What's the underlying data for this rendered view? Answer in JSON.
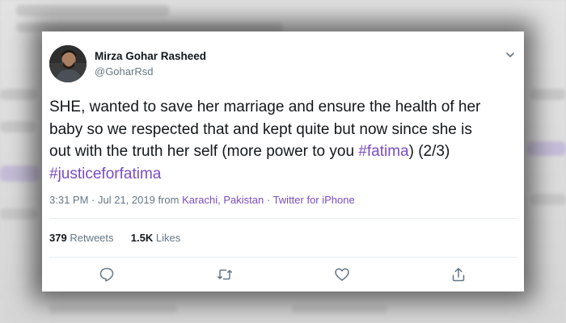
{
  "author": {
    "name": "Mirza Gohar Rasheed",
    "handle": "@GoharRsd"
  },
  "tweet": {
    "line1": "SHE, wanted to save her marriage and ensure the health of her",
    "line2": "baby so we respected that and kept quite but now since she is",
    "line3_start": "out with the truth her self (more power to you ",
    "hashtag_fatima": "#fatima",
    "line3_end": ") (2/3)",
    "hashtag_justice": "#justiceforfatima"
  },
  "meta": {
    "time": "3:31 PM",
    "separator1": " · ",
    "date": "Jul 21, 2019",
    "from_word": " from ",
    "location": "Karachi, Pakistan",
    "separator2": " · ",
    "source": "Twitter for iPhone"
  },
  "stats": {
    "retweets_count": "379",
    "retweets_label": "Retweets",
    "likes_count": "1.5K",
    "likes_label": "Likes"
  },
  "icons": {
    "menu": "chevron-down-icon",
    "reply": "reply-icon",
    "retweet": "retweet-icon",
    "like": "heart-icon",
    "share": "share-icon"
  },
  "colors": {
    "hashtag": "#794bc4",
    "text": "#14171a",
    "secondary": "#657786",
    "divider": "#e6ecf0",
    "card": "#ffffff"
  }
}
